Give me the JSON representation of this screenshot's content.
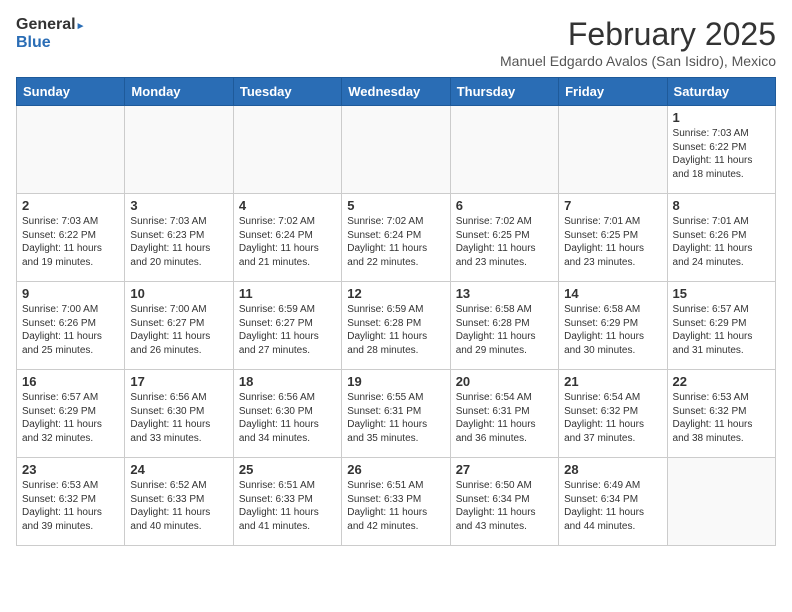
{
  "header": {
    "logo_line1": "General",
    "logo_line2": "Blue",
    "month_title": "February 2025",
    "subtitle": "Manuel Edgardo Avalos (San Isidro), Mexico"
  },
  "weekdays": [
    "Sunday",
    "Monday",
    "Tuesday",
    "Wednesday",
    "Thursday",
    "Friday",
    "Saturday"
  ],
  "weeks": [
    [
      {
        "day": "",
        "info": ""
      },
      {
        "day": "",
        "info": ""
      },
      {
        "day": "",
        "info": ""
      },
      {
        "day": "",
        "info": ""
      },
      {
        "day": "",
        "info": ""
      },
      {
        "day": "",
        "info": ""
      },
      {
        "day": "1",
        "info": "Sunrise: 7:03 AM\nSunset: 6:22 PM\nDaylight: 11 hours\nand 18 minutes."
      }
    ],
    [
      {
        "day": "2",
        "info": "Sunrise: 7:03 AM\nSunset: 6:22 PM\nDaylight: 11 hours\nand 19 minutes."
      },
      {
        "day": "3",
        "info": "Sunrise: 7:03 AM\nSunset: 6:23 PM\nDaylight: 11 hours\nand 20 minutes."
      },
      {
        "day": "4",
        "info": "Sunrise: 7:02 AM\nSunset: 6:24 PM\nDaylight: 11 hours\nand 21 minutes."
      },
      {
        "day": "5",
        "info": "Sunrise: 7:02 AM\nSunset: 6:24 PM\nDaylight: 11 hours\nand 22 minutes."
      },
      {
        "day": "6",
        "info": "Sunrise: 7:02 AM\nSunset: 6:25 PM\nDaylight: 11 hours\nand 23 minutes."
      },
      {
        "day": "7",
        "info": "Sunrise: 7:01 AM\nSunset: 6:25 PM\nDaylight: 11 hours\nand 23 minutes."
      },
      {
        "day": "8",
        "info": "Sunrise: 7:01 AM\nSunset: 6:26 PM\nDaylight: 11 hours\nand 24 minutes."
      }
    ],
    [
      {
        "day": "9",
        "info": "Sunrise: 7:00 AM\nSunset: 6:26 PM\nDaylight: 11 hours\nand 25 minutes."
      },
      {
        "day": "10",
        "info": "Sunrise: 7:00 AM\nSunset: 6:27 PM\nDaylight: 11 hours\nand 26 minutes."
      },
      {
        "day": "11",
        "info": "Sunrise: 6:59 AM\nSunset: 6:27 PM\nDaylight: 11 hours\nand 27 minutes."
      },
      {
        "day": "12",
        "info": "Sunrise: 6:59 AM\nSunset: 6:28 PM\nDaylight: 11 hours\nand 28 minutes."
      },
      {
        "day": "13",
        "info": "Sunrise: 6:58 AM\nSunset: 6:28 PM\nDaylight: 11 hours\nand 29 minutes."
      },
      {
        "day": "14",
        "info": "Sunrise: 6:58 AM\nSunset: 6:29 PM\nDaylight: 11 hours\nand 30 minutes."
      },
      {
        "day": "15",
        "info": "Sunrise: 6:57 AM\nSunset: 6:29 PM\nDaylight: 11 hours\nand 31 minutes."
      }
    ],
    [
      {
        "day": "16",
        "info": "Sunrise: 6:57 AM\nSunset: 6:29 PM\nDaylight: 11 hours\nand 32 minutes."
      },
      {
        "day": "17",
        "info": "Sunrise: 6:56 AM\nSunset: 6:30 PM\nDaylight: 11 hours\nand 33 minutes."
      },
      {
        "day": "18",
        "info": "Sunrise: 6:56 AM\nSunset: 6:30 PM\nDaylight: 11 hours\nand 34 minutes."
      },
      {
        "day": "19",
        "info": "Sunrise: 6:55 AM\nSunset: 6:31 PM\nDaylight: 11 hours\nand 35 minutes."
      },
      {
        "day": "20",
        "info": "Sunrise: 6:54 AM\nSunset: 6:31 PM\nDaylight: 11 hours\nand 36 minutes."
      },
      {
        "day": "21",
        "info": "Sunrise: 6:54 AM\nSunset: 6:32 PM\nDaylight: 11 hours\nand 37 minutes."
      },
      {
        "day": "22",
        "info": "Sunrise: 6:53 AM\nSunset: 6:32 PM\nDaylight: 11 hours\nand 38 minutes."
      }
    ],
    [
      {
        "day": "23",
        "info": "Sunrise: 6:53 AM\nSunset: 6:32 PM\nDaylight: 11 hours\nand 39 minutes."
      },
      {
        "day": "24",
        "info": "Sunrise: 6:52 AM\nSunset: 6:33 PM\nDaylight: 11 hours\nand 40 minutes."
      },
      {
        "day": "25",
        "info": "Sunrise: 6:51 AM\nSunset: 6:33 PM\nDaylight: 11 hours\nand 41 minutes."
      },
      {
        "day": "26",
        "info": "Sunrise: 6:51 AM\nSunset: 6:33 PM\nDaylight: 11 hours\nand 42 minutes."
      },
      {
        "day": "27",
        "info": "Sunrise: 6:50 AM\nSunset: 6:34 PM\nDaylight: 11 hours\nand 43 minutes."
      },
      {
        "day": "28",
        "info": "Sunrise: 6:49 AM\nSunset: 6:34 PM\nDaylight: 11 hours\nand 44 minutes."
      },
      {
        "day": "",
        "info": ""
      }
    ]
  ]
}
